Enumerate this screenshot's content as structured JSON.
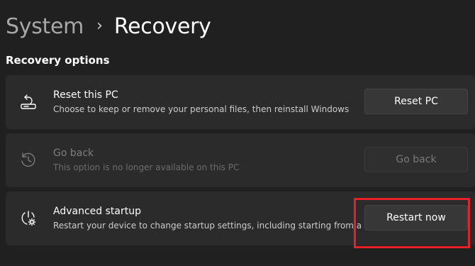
{
  "breadcrumb": {
    "parent": "System",
    "separator": "›",
    "current": "Recovery"
  },
  "section": {
    "title": "Recovery options"
  },
  "cards": [
    {
      "icon": "reset-pc-icon",
      "title": "Reset this PC",
      "description": "Choose to keep or remove your personal files, then reinstall Windows",
      "button": "Reset PC",
      "enabled": true
    },
    {
      "icon": "go-back-history-icon",
      "title": "Go back",
      "description": "This option is no longer available on this PC",
      "button": "Go back",
      "enabled": false
    },
    {
      "icon": "advanced-startup-icon",
      "title": "Advanced startup",
      "description": "Restart your device to change startup settings, including starting from a disc or USB drive",
      "button": "Restart now",
      "enabled": true
    }
  ],
  "colors": {
    "background": "#202020",
    "card": "#2b2b2b",
    "button": "#373737",
    "highlight": "#e8202a"
  }
}
